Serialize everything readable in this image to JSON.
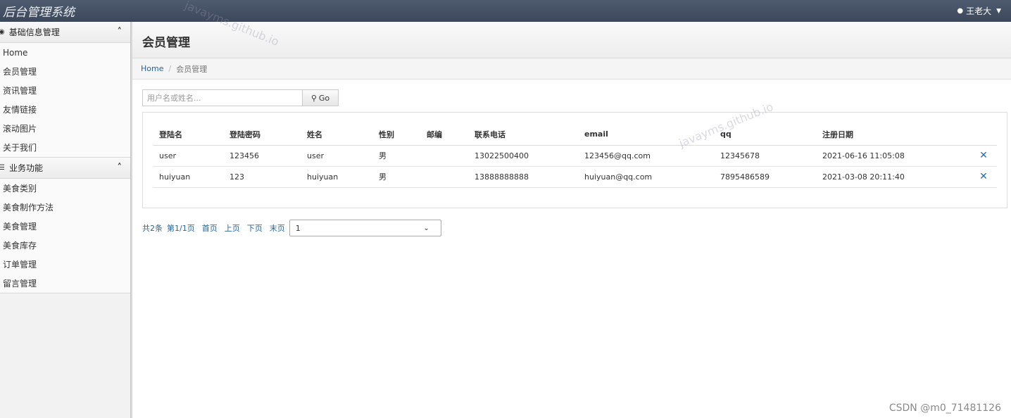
{
  "app": {
    "title": "后台管理系统"
  },
  "user": {
    "name": "王老大"
  },
  "sidebar": {
    "groups": [
      {
        "title": "基础信息管理",
        "items": [
          "Home",
          "会员管理",
          "资讯管理",
          "友情链接",
          "滚动图片",
          "关于我们"
        ]
      },
      {
        "title": "业务功能",
        "items": [
          "美食类别",
          "美食制作方法",
          "美食管理",
          "美食库存",
          "订单管理",
          "留言管理"
        ]
      }
    ]
  },
  "page": {
    "title": "会员管理"
  },
  "breadcrumb": {
    "home": "Home",
    "separator": "/",
    "current": "会员管理"
  },
  "search": {
    "placeholder": "用户名或姓名...",
    "button": "Go"
  },
  "table": {
    "headers": [
      "登陆名",
      "登陆密码",
      "姓名",
      "性别",
      "邮编",
      "联系电话",
      "email",
      "qq",
      "注册日期",
      ""
    ],
    "rows": [
      [
        "user",
        "123456",
        "user",
        "男",
        "",
        "13022500400",
        "123456@qq.com",
        "12345678",
        "2021-06-16 11:05:08",
        "✕"
      ],
      [
        "huiyuan",
        "123",
        "huiyuan",
        "男",
        "",
        "13888888888",
        "huiyuan@qq.com",
        "7895486589",
        "2021-03-08 20:11:40",
        "✕"
      ]
    ]
  },
  "pager": {
    "total": "共2条",
    "current": "第1/1页",
    "first": "首页",
    "prev": "上页",
    "next": "下页",
    "last": "末页",
    "selected": "1"
  },
  "watermarks": [
    "javayms.github.io",
    "javayms.github.io"
  ],
  "footer": {
    "credit": "CSDN @m0_71481126"
  },
  "colors": {
    "navbar": "#46526a",
    "link": "#2a6496"
  }
}
